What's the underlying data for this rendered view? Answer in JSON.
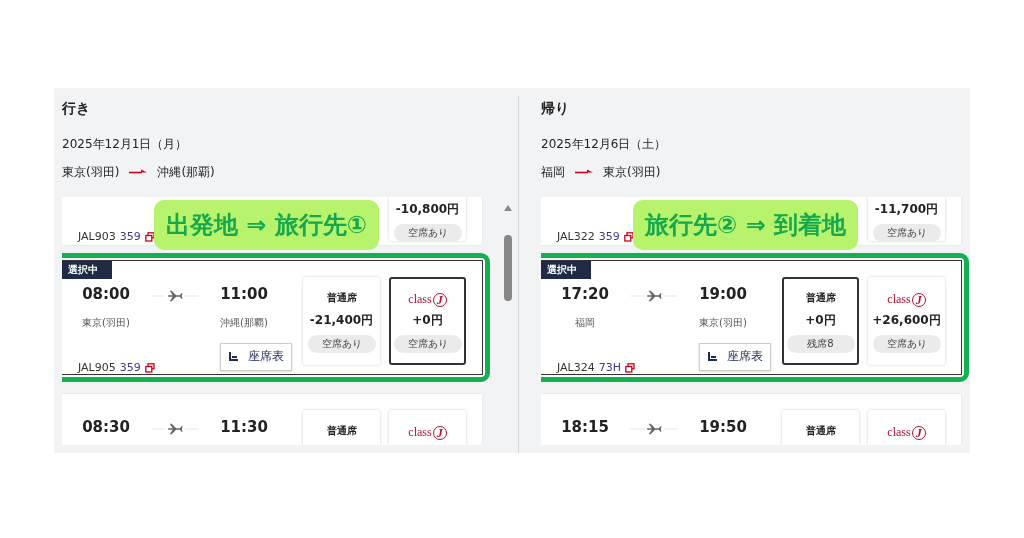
{
  "panels": [
    {
      "heading": "行き",
      "date": "2025年12月1日（月）",
      "from": "東京(羽田)",
      "to": "沖縄(那覇)",
      "annotation": "出発地 ⇒ 旅行先①",
      "flights": [
        {
          "selected": false,
          "flight_no": "JAL903",
          "aircraft": "359",
          "fares": [
            {
              "kind": "class_j",
              "price": "-10,800円",
              "availability": "空席あり",
              "selected": false
            }
          ]
        },
        {
          "selected": true,
          "badge": "選択中",
          "depart": "08:00",
          "origin": "東京(羽田)",
          "arrive": "11:00",
          "destination": "沖縄(那覇)",
          "flight_no": "JAL905",
          "aircraft": "359",
          "seat_map": "座席表",
          "fares": [
            {
              "kind": "standard",
              "label": "普通席",
              "price": "-21,400円",
              "availability": "空席あり",
              "selected": false
            },
            {
              "kind": "class_j",
              "logo_text": "class",
              "logo_mark": "J",
              "price": "+0円",
              "availability": "空席あり",
              "selected": true
            }
          ]
        },
        {
          "selected": false,
          "depart": "08:30",
          "arrive": "11:30",
          "fares": [
            {
              "kind": "standard",
              "label": "普通席",
              "selected": false
            },
            {
              "kind": "class_j",
              "logo_text": "class",
              "logo_mark": "J",
              "selected": false
            }
          ]
        }
      ]
    },
    {
      "heading": "帰り",
      "date": "2025年12月6日（土）",
      "from": "福岡",
      "to": "東京(羽田)",
      "annotation": "旅行先② ⇒ 到着地",
      "flights": [
        {
          "selected": false,
          "flight_no": "JAL322",
          "aircraft": "359",
          "fares": [
            {
              "kind": "class_j",
              "price": "-11,700円",
              "availability": "空席あり",
              "selected": false
            }
          ]
        },
        {
          "selected": true,
          "badge": "選択中",
          "depart": "17:20",
          "origin": "福岡",
          "arrive": "19:00",
          "destination": "東京(羽田)",
          "flight_no": "JAL324",
          "aircraft": "73H",
          "seat_map": "座席表",
          "fares": [
            {
              "kind": "standard",
              "label": "普通席",
              "price": "+0円",
              "availability": "残席8",
              "selected": true
            },
            {
              "kind": "class_j",
              "logo_text": "class",
              "logo_mark": "J",
              "price": "+26,600円",
              "availability": "空席あり",
              "selected": false
            }
          ]
        },
        {
          "selected": false,
          "depart": "18:15",
          "arrive": "19:50",
          "fares": [
            {
              "kind": "standard",
              "label": "普通席",
              "selected": false
            },
            {
              "kind": "class_j",
              "logo_text": "class",
              "logo_mark": "J",
              "selected": false
            }
          ]
        }
      ]
    }
  ]
}
